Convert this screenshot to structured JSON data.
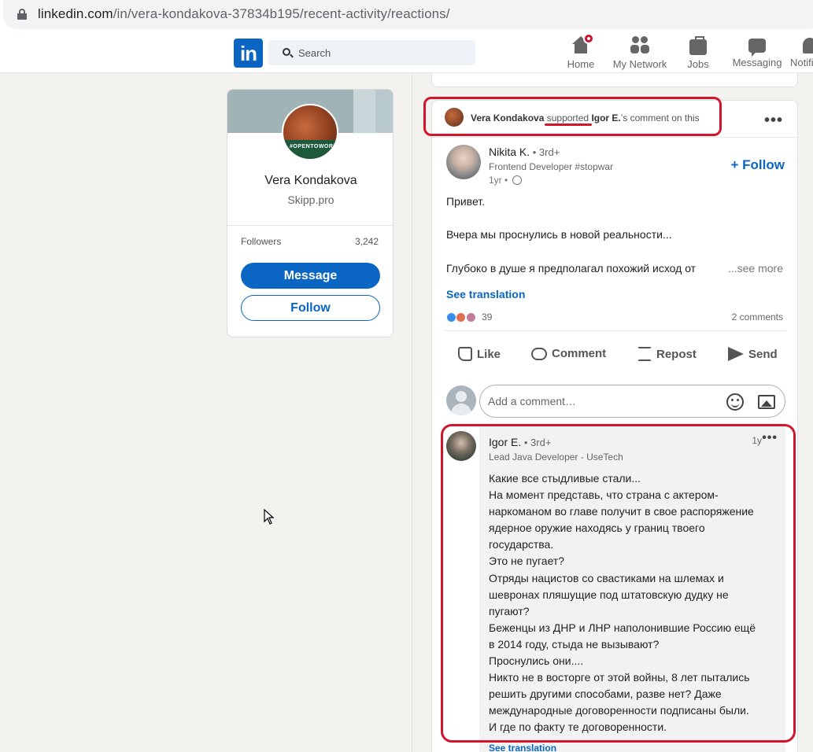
{
  "browser": {
    "url_host": "linkedin.com",
    "url_path": "/in/vera-kondakova-37834b195/recent-activity/reactions/"
  },
  "nav": {
    "logo": "in",
    "search_placeholder": "Search",
    "items": [
      {
        "label": "Home"
      },
      {
        "label": "My Network"
      },
      {
        "label": "Jobs"
      },
      {
        "label": "Messaging"
      },
      {
        "label": "Notifi"
      }
    ]
  },
  "profile": {
    "name": "Vera Kondakova",
    "company": "Skipp.pro",
    "avatar_ring_text": "#OPENTOWORK",
    "followers_label": "Followers",
    "followers_count": "3,242",
    "message_button": "Message",
    "follow_button": "Follow"
  },
  "activity": {
    "actor": "Vera Kondakova",
    "verb": "supported",
    "target": "Igor E.",
    "suffix": "’s comment on this"
  },
  "post": {
    "author_name": "Nikita K.",
    "author_degree": " • 3rd+",
    "author_headline": "Frontend Developer #stopwar",
    "time": "1yr • ",
    "follow_label": "+ Follow",
    "lines": [
      "Привет.",
      "Вчера мы проснулись в новой реальности...",
      "Глубоко в душе я предполагал похожий исход от"
    ],
    "see_more": "...see more",
    "see_translation": "See translation",
    "reaction_count": "39",
    "comments_count": "2 comments"
  },
  "actions": {
    "like": "Like",
    "comment": "Comment",
    "repost": "Repost",
    "send": "Send"
  },
  "comment_box": {
    "placeholder": "Add a comment…"
  },
  "comment": {
    "author_name": "Igor E.",
    "author_degree": " • 3rd+",
    "headline": "Lead Java Developer - UseTech",
    "time": "1y",
    "lines": [
      "Какие все стыдливые стали...",
      "На момент представь, что страна с актером-",
      "наркоманом во главе получит в свое распоряжение",
      "ядерное оружие находясь у границ твоего",
      "государства.",
      "Это не пугает?",
      "Отряды нацистов со свастиками на шлемах и",
      "шевронах пляшущие под штатовскую дудку не",
      "пугают?",
      "Беженцы из ДНР и ЛНР наполонившие Россию ещё",
      "в 2014 году, стыда не вызывают?",
      "Проснулись они....",
      "Никто не в восторге от этой войны, 8 лет пытались",
      "решить другими способами, разве нет? Даже",
      "международные договоренности подписаны были.",
      "И где по факту те договоренности."
    ],
    "see_translation": "See translation"
  },
  "colors": {
    "linkedin_blue": "#0a66c2",
    "annotation_red": "#d3152b",
    "page_bg": "#f3f2ef"
  }
}
